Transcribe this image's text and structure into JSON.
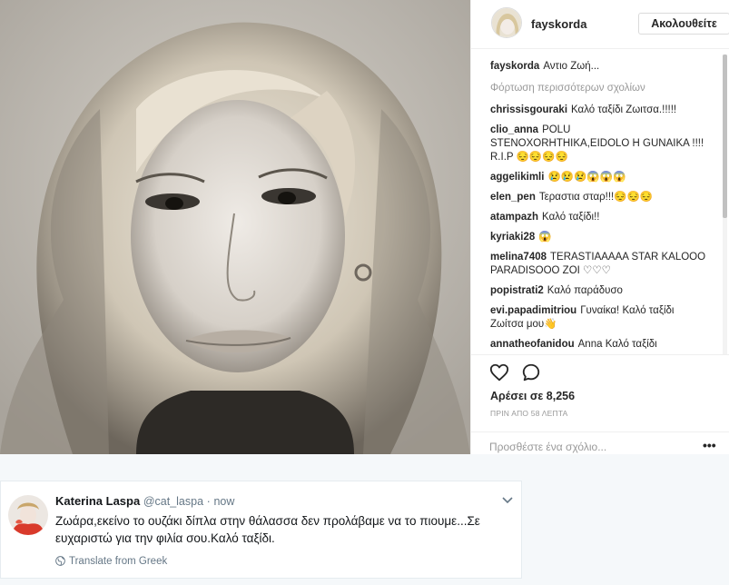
{
  "instagram": {
    "username": "fayskorda",
    "follow_label": "Ακολουθείτε",
    "caption": {
      "user": "fayskorda",
      "text": "Αντιο Ζωή..."
    },
    "load_more": "Φόρτωση περισσότερων σχολίων",
    "comments": [
      {
        "user": "chrissisgouraki",
        "text": "Καλό ταξίδι Ζωιτσα.!!!!!"
      },
      {
        "user": "clio_anna",
        "text": "POLU STENOXORHTHIKA,EIDOLO H GUNAIKA !!!! R.I.P 😔😔😔😔"
      },
      {
        "user": "aggelikimli",
        "text": "😢😢😢😱😱😱"
      },
      {
        "user": "elen_pen",
        "text": "Τεραστια σταρ!!!😔😔😔"
      },
      {
        "user": "atampazh",
        "text": "Καλό ταξίδι!!"
      },
      {
        "user": "kyriaki28",
        "text": "😱"
      },
      {
        "user": "melina7408",
        "text": "TERASTIAAAAA STAR KALOOO PARADISOOO ZOI ♡♡♡"
      },
      {
        "user": "popistrati2",
        "text": "Καλό παράδυσο"
      },
      {
        "user": "evi.papadimitriou",
        "text": "Γυναίκα! Καλό ταξίδι Ζωίτσα μου👋"
      },
      {
        "user": "annatheofanidou",
        "text": "Anna Καλό ταξίδι"
      }
    ],
    "like_icon": "heart-outline-icon",
    "comment_icon": "speech-bubble-icon",
    "likes": "Αρέσει σε 8,256",
    "time": "ΠΡΙΝ ΑΠΟ 58 ΛΕΠΤΑ",
    "add_comment_placeholder": "Προσθέστε ένα σχόλιο...",
    "more_options": "•••"
  },
  "tweet": {
    "name": "Katerina Laspa",
    "handle": "@cat_laspa",
    "separator": "·",
    "time": "now",
    "text": "Ζωάρα,εκείνο το ουζάκι δίπλα στην θάλασσα δεν προλάβαμε να το πιουμε...Σε ευχαριστώ για την φιλία σου.Καλό ταξίδι.",
    "translate": "Translate from Greek"
  },
  "colors": {
    "tweet_name": "#14171a",
    "tweet_meta": "#657786",
    "ig_text": "#262626",
    "ig_muted": "#999999"
  }
}
